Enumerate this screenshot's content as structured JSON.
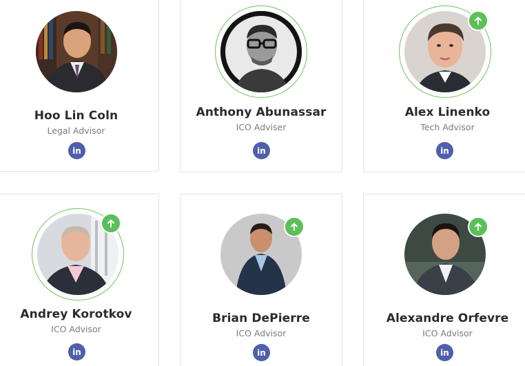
{
  "advisors": [
    {
      "name": "Hoo Lin Coln",
      "role": "Legal Advisor",
      "social_label": "in",
      "highlighted": false
    },
    {
      "name": "Anthony Abunassar",
      "role": "ICO Adviser",
      "social_label": "in",
      "highlighted": true
    },
    {
      "name": "Alex Linenko",
      "role": "Tech Advisor",
      "social_label": "in",
      "highlighted": true
    },
    {
      "name": "Andrey Korotkov",
      "role": "ICO Advisor",
      "social_label": "in",
      "highlighted": true
    },
    {
      "name": "Brian DePierre",
      "role": "ICO Advisor",
      "social_label": "in",
      "highlighted": false
    },
    {
      "name": "Alexandre Orfevre",
      "role": "ICO Advisor",
      "social_label": "in",
      "highlighted": false
    }
  ],
  "colors": {
    "accent_green": "#5cbf58",
    "linkedin_blue": "#4e5fac",
    "name_text": "#2b2b2b",
    "role_text": "#7a7a7a"
  },
  "icons": {
    "badge": "arrow-up-icon",
    "social": "linkedin-icon"
  }
}
